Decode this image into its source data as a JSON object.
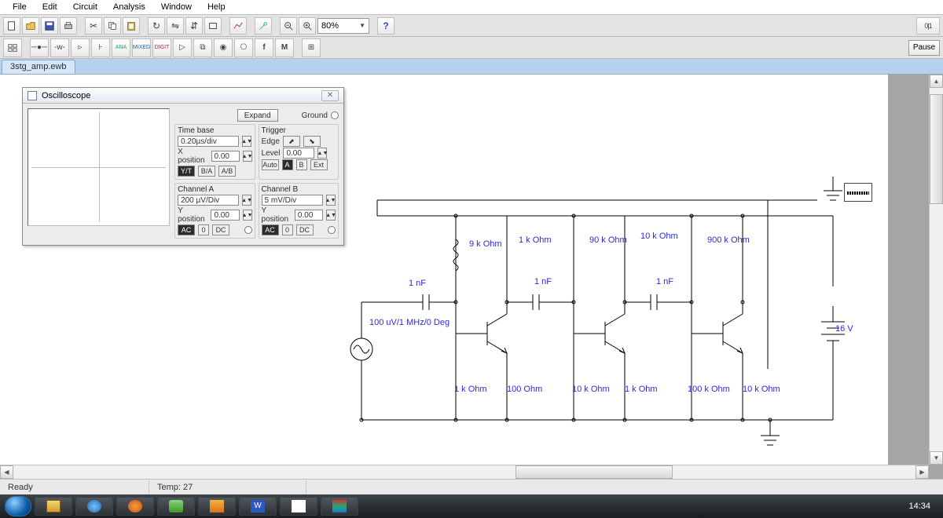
{
  "menu": {
    "file": "File",
    "edit": "Edit",
    "circuit": "Circuit",
    "analysis": "Analysis",
    "window": "Window",
    "help": "Help"
  },
  "toolbar1": {
    "zoom": "80%",
    "help": "?",
    "switch_label": "0|1"
  },
  "toolbar2": {
    "pause": "Pause"
  },
  "tab": {
    "label": "3stg_amp.ewb"
  },
  "scope": {
    "title": "Oscilloscope",
    "expand": "Expand",
    "ground": "Ground",
    "timebase_hd": "Time base",
    "timebase_val": "0.20µs/div",
    "xpos_lbl": "X position",
    "xpos_val": "0.00",
    "yt": "Y/T",
    "ba": "B/A",
    "ab": "A/B",
    "trigger_hd": "Trigger",
    "edge": "Edge",
    "level": "Level",
    "level_val": "0.00",
    "auto": "Auto",
    "a": "A",
    "b": "B",
    "ext": "Ext",
    "cha_hd": "Channel A",
    "cha_scale": "200 µV/Div",
    "chb_hd": "Channel B",
    "chb_scale": "5 mV/Div",
    "ypos_lbl": "Y position",
    "ypos_val": "0.00",
    "ac": "AC",
    "zero": "0",
    "dc": "DC"
  },
  "circuit": {
    "source": "100 uV/1 MHz/0 Deg",
    "c1": "1 nF",
    "c2": "1 nF",
    "c3": "1 nF",
    "r1": "9 k Ohm",
    "r2": "1 k Ohm",
    "r3": "90 k Ohm",
    "r4": "10 k Ohm",
    "r5": "900 k Ohm",
    "r6": "1 k Ohm",
    "r7": "100  Ohm",
    "r8": "10 k Ohm",
    "r9": "1 k Ohm",
    "r10": "100 k Ohm",
    "r11": "10 k Ohm",
    "vcc": "16 V"
  },
  "status": {
    "ready": "Ready",
    "temp": "Temp:  27"
  },
  "taskbar": {
    "clock": "14:34"
  }
}
